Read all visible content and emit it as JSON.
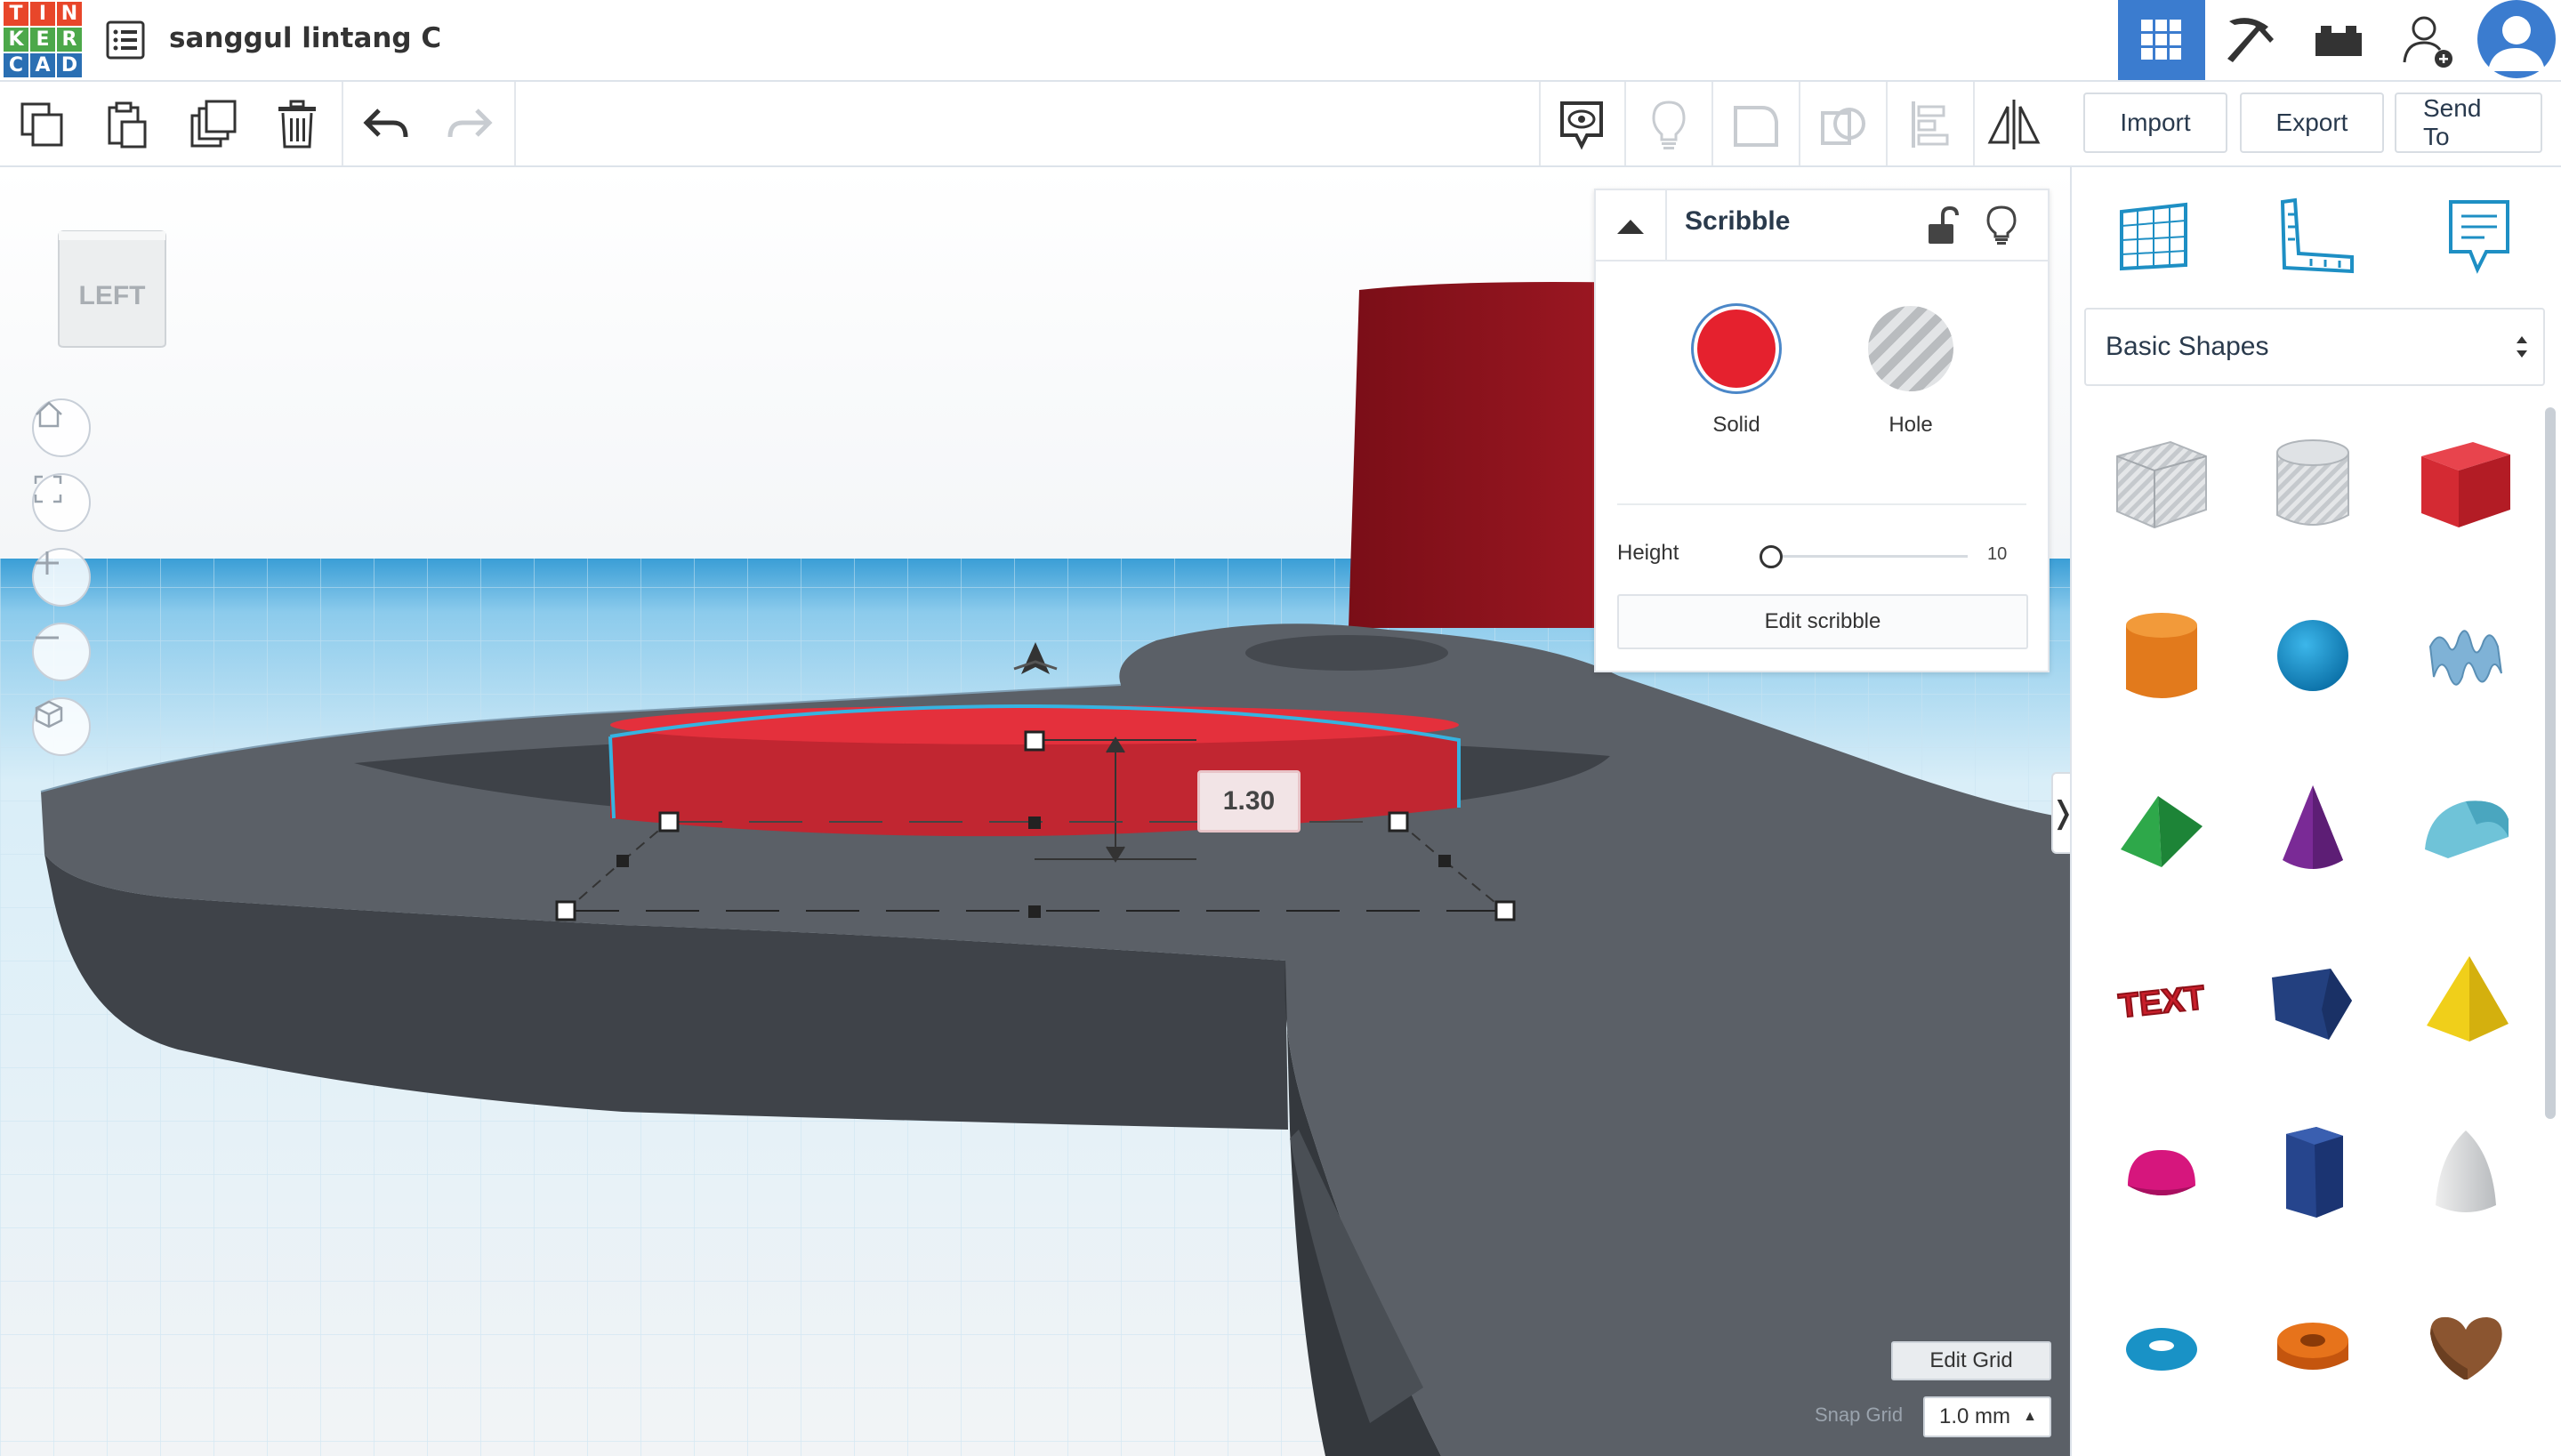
{
  "app": {
    "logo_letters": [
      "T",
      "I",
      "N",
      "K",
      "E",
      "R",
      "C",
      "A",
      "D"
    ],
    "logo_colors": [
      "#e8462a",
      "#e8462a",
      "#e8462a",
      "#4ca84a",
      "#4ca84a",
      "#4ca84a",
      "#2a6fb3",
      "#2a6fb3",
      "#2a6fb3"
    ],
    "document_title": "sanggul lintang C"
  },
  "topbar": {
    "icons": [
      "grid-view-icon",
      "pickaxe-icon",
      "brick-icon",
      "add-user-icon",
      "avatar"
    ],
    "active_color": "#3b7ccf"
  },
  "toolbar": {
    "left_tools": [
      "copy-icon",
      "paste-icon",
      "duplicate-icon",
      "trash-icon",
      "undo-icon",
      "redo-icon"
    ],
    "right_tools": [
      "notes-icon",
      "bulb-icon",
      "group-icon",
      "ungroup-icon",
      "align-icon",
      "mirror-icon"
    ],
    "import_label": "Import",
    "export_label": "Export",
    "send_to_label": "Send To"
  },
  "viewport": {
    "viewcube_label": "LEFT",
    "nav_buttons": [
      "home-icon",
      "fit-icon",
      "zoom-in-icon",
      "zoom-out-icon",
      "view-mode-icon"
    ],
    "dimension_value": "1.30"
  },
  "inspector": {
    "title": "Scribble",
    "solid_label": "Solid",
    "hole_label": "Hole",
    "solid_color": "#e5212e",
    "height_label": "Height",
    "height_value": "10",
    "edit_button": "Edit scribble"
  },
  "grid": {
    "edit_grid_label": "Edit Grid",
    "snap_grid_label": "Snap Grid",
    "snap_value": "1.0 mm"
  },
  "right_panel": {
    "tabs": [
      "workplane-icon",
      "ruler-icon",
      "notes-icon"
    ],
    "library_selected": "Basic Shapes",
    "shapes": [
      "box-hole-icon",
      "cylinder-hole-icon",
      "box-icon",
      "cylinder-icon",
      "sphere-icon",
      "scribble-icon",
      "roof-icon",
      "cone-icon",
      "round-roof-icon",
      "text-icon",
      "polygon-icon",
      "pyramid-icon",
      "half-sphere-icon",
      "hexagonal-prism-icon",
      "paraboloid-icon",
      "torus-icon",
      "tube-icon",
      "heart-icon"
    ],
    "text_shape_label": "TEXT"
  },
  "colors": {
    "accent": "#3b7ccf",
    "model_gray": "#555a60",
    "shape_red": "#d9333f",
    "highlight_cyan": "#36b3e0"
  }
}
